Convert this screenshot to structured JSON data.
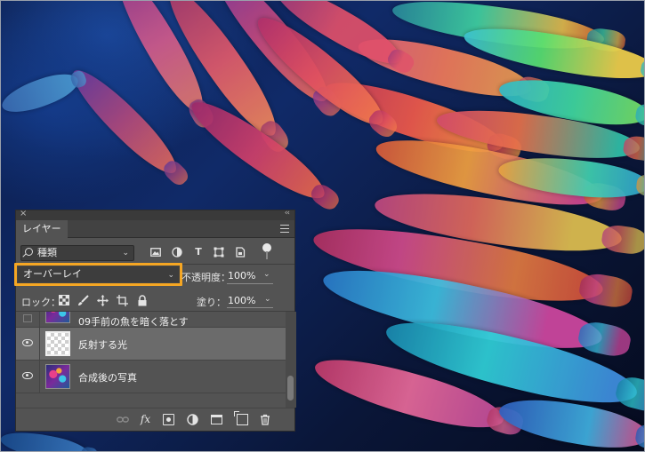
{
  "panel": {
    "close_glyph": "×",
    "collapse_glyph": "‹‹",
    "tab_label": "レイヤー",
    "filter": {
      "kind_label": "種類",
      "filter_icons": [
        "image-filter-icon",
        "adjustment-filter-icon",
        "text-filter-icon",
        "shape-filter-icon",
        "smart-object-filter-icon"
      ]
    },
    "blend_mode": "オーバーレイ",
    "opacity_label": "不透明度：",
    "opacity_value": "100%",
    "lock_label": "ロック：",
    "fill_label": "塗り：",
    "fill_value": "100%",
    "layers": [
      {
        "name": "09手前の魚を暗く落とす",
        "visible": false,
        "thumbnail": "fish-photo",
        "selected": false
      },
      {
        "name": "反射する光",
        "visible": true,
        "thumbnail": "transparent",
        "selected": true
      },
      {
        "name": "合成後の写真",
        "visible": true,
        "thumbnail": "fish-photo",
        "selected": false
      }
    ],
    "bottom_icons": [
      "link-icon",
      "fx-icon",
      "mask-icon",
      "adjustment-layer-icon",
      "group-folder-icon",
      "new-layer-icon",
      "trash-icon"
    ],
    "fx_label": "fx"
  },
  "colors": {
    "highlight_border": "#f5a623",
    "panel_bg": "#535353",
    "selected_layer_bg": "#6b6b6b"
  }
}
